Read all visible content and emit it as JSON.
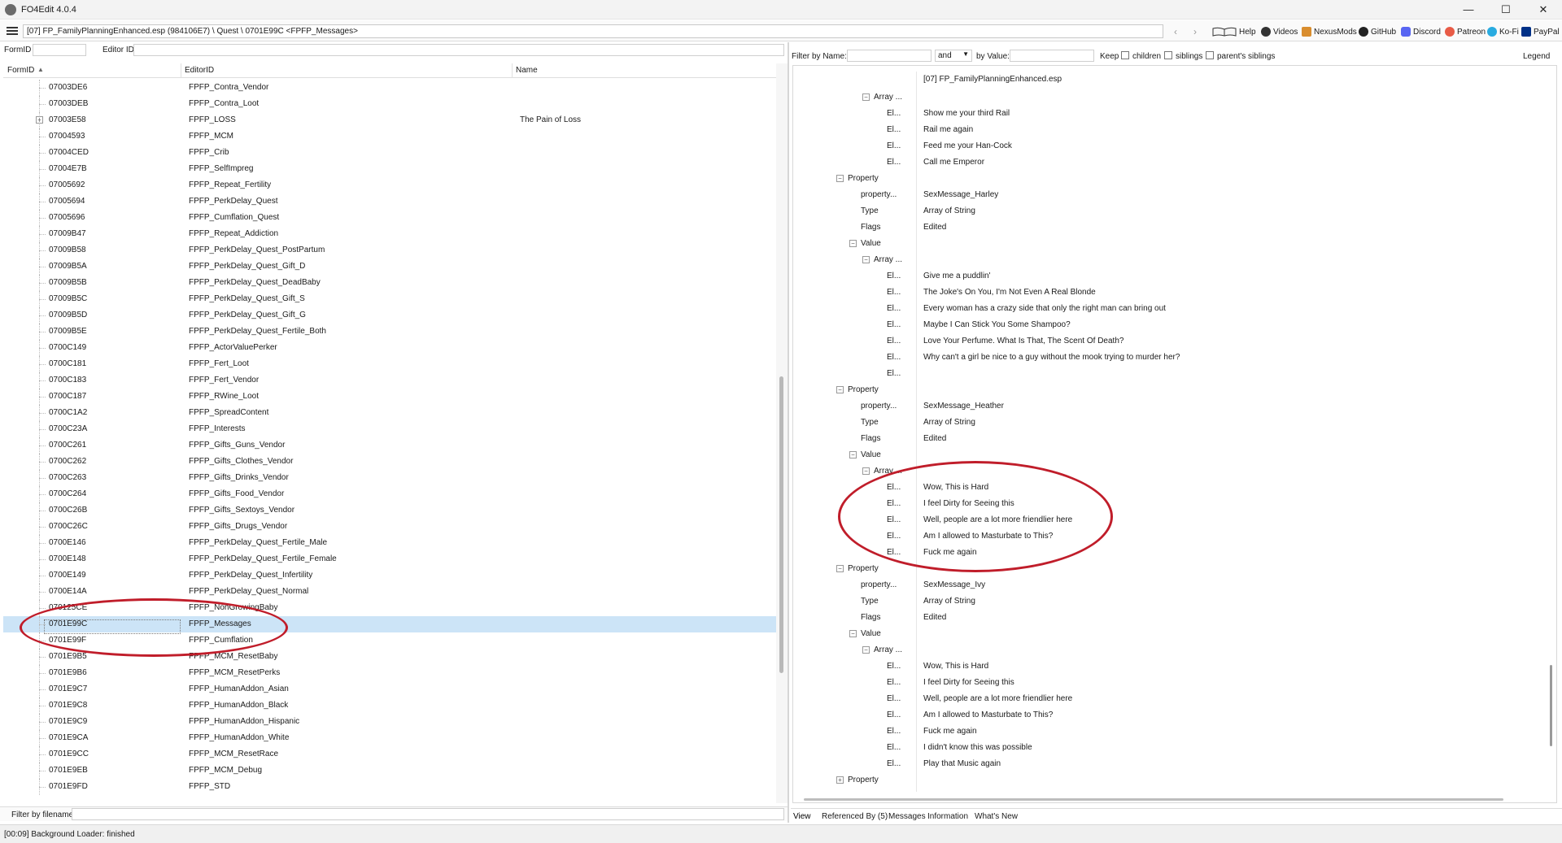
{
  "window": {
    "title": "FO4Edit 4.0.4",
    "minimize": "—",
    "maximize": "☐",
    "close": "✕"
  },
  "toolbar": {
    "path": "[07] FP_FamilyPlanningEnhanced.esp (984106E7) \\ Quest \\ 0701E99C <FPFP_Messages>",
    "back": "‹",
    "forward": "›",
    "links": [
      "Help",
      "Videos",
      "NexusMods",
      "GitHub",
      "Discord",
      "Patreon",
      "Ko-Fi",
      "PayPal"
    ]
  },
  "left": {
    "formid_label": "FormID",
    "editorid_label": "Editor ID",
    "columns": [
      "FormID",
      "EditorID",
      "Name"
    ],
    "sort_indicator": "▲",
    "rows": [
      {
        "formid": "07003DE6",
        "editorid": "FPFP_Contra_Vendor",
        "name": ""
      },
      {
        "formid": "07003DEB",
        "editorid": "FPFP_Contra_Loot",
        "name": ""
      },
      {
        "formid": "07003E58",
        "editorid": "FPFP_LOSS",
        "name": "The Pain of Loss",
        "expandable": true
      },
      {
        "formid": "07004593",
        "editorid": "FPFP_MCM",
        "name": ""
      },
      {
        "formid": "07004CED",
        "editorid": "FPFP_Crib",
        "name": ""
      },
      {
        "formid": "07004E7B",
        "editorid": "FPFP_SelfImpreg",
        "name": ""
      },
      {
        "formid": "07005692",
        "editorid": "FPFP_Repeat_Fertility",
        "name": ""
      },
      {
        "formid": "07005694",
        "editorid": "FPFP_PerkDelay_Quest",
        "name": ""
      },
      {
        "formid": "07005696",
        "editorid": "FPFP_Cumflation_Quest",
        "name": ""
      },
      {
        "formid": "07009B47",
        "editorid": "FPFP_Repeat_Addiction",
        "name": ""
      },
      {
        "formid": "07009B58",
        "editorid": "FPFP_PerkDelay_Quest_PostPartum",
        "name": ""
      },
      {
        "formid": "07009B5A",
        "editorid": "FPFP_PerkDelay_Quest_Gift_D",
        "name": ""
      },
      {
        "formid": "07009B5B",
        "editorid": "FPFP_PerkDelay_Quest_DeadBaby",
        "name": ""
      },
      {
        "formid": "07009B5C",
        "editorid": "FPFP_PerkDelay_Quest_Gift_S",
        "name": ""
      },
      {
        "formid": "07009B5D",
        "editorid": "FPFP_PerkDelay_Quest_Gift_G",
        "name": ""
      },
      {
        "formid": "07009B5E",
        "editorid": "FPFP_PerkDelay_Quest_Fertile_Both",
        "name": ""
      },
      {
        "formid": "0700C149",
        "editorid": "FPFP_ActorValuePerker",
        "name": ""
      },
      {
        "formid": "0700C181",
        "editorid": "FPFP_Fert_Loot",
        "name": ""
      },
      {
        "formid": "0700C183",
        "editorid": "FPFP_Fert_Vendor",
        "name": ""
      },
      {
        "formid": "0700C187",
        "editorid": "FPFP_RWine_Loot",
        "name": ""
      },
      {
        "formid": "0700C1A2",
        "editorid": "FPFP_SpreadContent",
        "name": ""
      },
      {
        "formid": "0700C23A",
        "editorid": "FPFP_Interests",
        "name": ""
      },
      {
        "formid": "0700C261",
        "editorid": "FPFP_Gifts_Guns_Vendor",
        "name": ""
      },
      {
        "formid": "0700C262",
        "editorid": "FPFP_Gifts_Clothes_Vendor",
        "name": ""
      },
      {
        "formid": "0700C263",
        "editorid": "FPFP_Gifts_Drinks_Vendor",
        "name": ""
      },
      {
        "formid": "0700C264",
        "editorid": "FPFP_Gifts_Food_Vendor",
        "name": ""
      },
      {
        "formid": "0700C26B",
        "editorid": "FPFP_Gifts_Sextoys_Vendor",
        "name": ""
      },
      {
        "formid": "0700C26C",
        "editorid": "FPFP_Gifts_Drugs_Vendor",
        "name": ""
      },
      {
        "formid": "0700E146",
        "editorid": "FPFP_PerkDelay_Quest_Fertile_Male",
        "name": ""
      },
      {
        "formid": "0700E148",
        "editorid": "FPFP_PerkDelay_Quest_Fertile_Female",
        "name": ""
      },
      {
        "formid": "0700E149",
        "editorid": "FPFP_PerkDelay_Quest_Infertility",
        "name": ""
      },
      {
        "formid": "0700E14A",
        "editorid": "FPFP_PerkDelay_Quest_Normal",
        "name": ""
      },
      {
        "formid": "070125CE",
        "editorid": "FPFP_NonGrowingBaby",
        "name": ""
      },
      {
        "formid": "0701E99C",
        "editorid": "FPFP_Messages",
        "name": "",
        "selected": true
      },
      {
        "formid": "0701E99F",
        "editorid": "FPFP_Cumflation",
        "name": ""
      },
      {
        "formid": "0701E9B5",
        "editorid": "FPFP_MCM_ResetBaby",
        "name": ""
      },
      {
        "formid": "0701E9B6",
        "editorid": "FPFP_MCM_ResetPerks",
        "name": ""
      },
      {
        "formid": "0701E9C7",
        "editorid": "FPFP_HumanAddon_Asian",
        "name": ""
      },
      {
        "formid": "0701E9C8",
        "editorid": "FPFP_HumanAddon_Black",
        "name": ""
      },
      {
        "formid": "0701E9C9",
        "editorid": "FPFP_HumanAddon_Hispanic",
        "name": ""
      },
      {
        "formid": "0701E9CA",
        "editorid": "FPFP_HumanAddon_White",
        "name": ""
      },
      {
        "formid": "0701E9CC",
        "editorid": "FPFP_MCM_ResetRace",
        "name": ""
      },
      {
        "formid": "0701E9EB",
        "editorid": "FPFP_MCM_Debug",
        "name": ""
      },
      {
        "formid": "0701E9FD",
        "editorid": "FPFP_STD",
        "name": ""
      }
    ],
    "filename_filter_label": "Filter by filename:"
  },
  "right": {
    "filter_name_label": "Filter by Name:",
    "and_or_value": "and",
    "filter_value_label": "by Value:",
    "keep_label": "Keep",
    "checkboxes": [
      "children",
      "siblings",
      "parent's siblings"
    ],
    "legend": "Legend",
    "file_header": "[07] FP_FamilyPlanningEnhanced.esp",
    "tree": [
      {
        "label": "Array ...",
        "value": "",
        "indent": 3,
        "exp": "−"
      },
      {
        "label": "El...",
        "value": "Show me your third Rail",
        "indent": 4
      },
      {
        "label": "El...",
        "value": "Rail me again",
        "indent": 4
      },
      {
        "label": "El...",
        "value": "Feed me your Han-Cock",
        "indent": 4
      },
      {
        "label": "El...",
        "value": "Call me Emperor",
        "indent": 4
      },
      {
        "label": "Property",
        "value": "",
        "indent": 1,
        "exp": "−"
      },
      {
        "label": "property...",
        "value": "SexMessage_Harley",
        "indent": 2
      },
      {
        "label": "Type",
        "value": "Array of String",
        "indent": 2
      },
      {
        "label": "Flags",
        "value": "Edited",
        "indent": 2
      },
      {
        "label": "Value",
        "value": "",
        "indent": 2,
        "exp": "−"
      },
      {
        "label": "Array ...",
        "value": "",
        "indent": 3,
        "exp": "−"
      },
      {
        "label": "El...",
        "value": "Give me a puddlin'",
        "indent": 4
      },
      {
        "label": "El...",
        "value": "The Joke's On You, I'm Not Even A Real Blonde",
        "indent": 4
      },
      {
        "label": "El...",
        "value": "Every woman has a crazy side that only the right man can bring out",
        "indent": 4
      },
      {
        "label": "El...",
        "value": "Maybe I Can Stick You Some Shampoo?",
        "indent": 4
      },
      {
        "label": "El...",
        "value": "Love Your Perfume. What Is That, The Scent Of Death?",
        "indent": 4
      },
      {
        "label": "El...",
        "value": "Why can't a girl be nice to a guy without the mook trying to murder her?",
        "indent": 4
      },
      {
        "label": "El...",
        "value": "",
        "indent": 4
      },
      {
        "label": "Property",
        "value": "",
        "indent": 1,
        "exp": "−"
      },
      {
        "label": "property...",
        "value": "SexMessage_Heather",
        "indent": 2
      },
      {
        "label": "Type",
        "value": "Array of String",
        "indent": 2
      },
      {
        "label": "Flags",
        "value": "Edited",
        "indent": 2
      },
      {
        "label": "Value",
        "value": "",
        "indent": 2,
        "exp": "−"
      },
      {
        "label": "Array ...",
        "value": "",
        "indent": 3,
        "exp": "−"
      },
      {
        "label": "El...",
        "value": "Wow, This is Hard",
        "indent": 4
      },
      {
        "label": "El...",
        "value": "I feel Dirty for Seeing this",
        "indent": 4
      },
      {
        "label": "El...",
        "value": "Well, people are a lot more friendlier here",
        "indent": 4
      },
      {
        "label": "El...",
        "value": "Am I allowed to Masturbate to This?",
        "indent": 4
      },
      {
        "label": "El...",
        "value": "Fuck me again",
        "indent": 4
      },
      {
        "label": "Property",
        "value": "",
        "indent": 1,
        "exp": "−"
      },
      {
        "label": "property...",
        "value": "SexMessage_Ivy",
        "indent": 2
      },
      {
        "label": "Type",
        "value": "Array of String",
        "indent": 2
      },
      {
        "label": "Flags",
        "value": "Edited",
        "indent": 2
      },
      {
        "label": "Value",
        "value": "",
        "indent": 2,
        "exp": "−"
      },
      {
        "label": "Array ...",
        "value": "",
        "indent": 3,
        "exp": "−"
      },
      {
        "label": "El...",
        "value": "Wow, This is Hard",
        "indent": 4
      },
      {
        "label": "El...",
        "value": "I feel Dirty for Seeing this",
        "indent": 4
      },
      {
        "label": "El...",
        "value": "Well, people are a lot more friendlier here",
        "indent": 4
      },
      {
        "label": "El...",
        "value": "Am I allowed to Masturbate to This?",
        "indent": 4
      },
      {
        "label": "El...",
        "value": "Fuck me again",
        "indent": 4
      },
      {
        "label": "El...",
        "value": "I didn't know this was possible",
        "indent": 4
      },
      {
        "label": "El...",
        "value": "Play that Music again",
        "indent": 4
      },
      {
        "label": "Property",
        "value": "",
        "indent": 1,
        "exp": "+"
      }
    ],
    "tabs": [
      "View",
      "Referenced By (5)",
      "Messages",
      "Information",
      "What's New"
    ]
  },
  "status": {
    "text": "[00:09] Background Loader: finished"
  },
  "colors": {
    "selection": "#cce4f7",
    "annotation": "#c01d2a"
  }
}
